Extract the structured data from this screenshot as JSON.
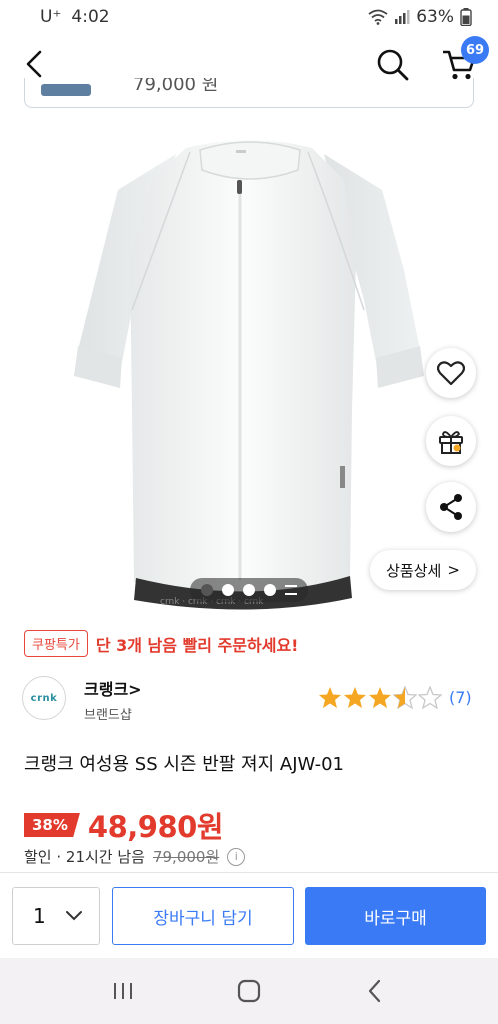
{
  "status_bar": {
    "carrier": "U⁺",
    "time": "4:02",
    "battery": "63%"
  },
  "top_nav": {
    "cart_count": "69"
  },
  "peek_card": {
    "price_fragment": "79,000 원"
  },
  "product_image": {
    "alt": "white cycling jersey",
    "carousel": {
      "total_dots": 4,
      "active_index": 0
    }
  },
  "floating_actions": {
    "detail_label": "상품상세",
    "detail_chevron": ">"
  },
  "urgency": {
    "badge": "쿠팡특가",
    "message": "단 3개 남음 빨리 주문하세요!"
  },
  "brand": {
    "logo_text": "crnk",
    "name": "크랭크>",
    "sub": "브랜드샵",
    "rating_value": 3.5,
    "rating_max": 5,
    "review_count": "(7)"
  },
  "product": {
    "title": "크랭크 여성용 SS 시즌 반팔 져지 AJW-01"
  },
  "price": {
    "discount": "38%",
    "sale_price": "48,980원",
    "meta_label": "할인 · 21시간 남음",
    "original_price": "79,000원",
    "info_icon": "i"
  },
  "buy_bar": {
    "quantity": "1",
    "add_to_cart": "장바구니 담기",
    "buy_now": "바로구매"
  },
  "colors": {
    "accent_blue": "#3a7bf5",
    "sale_red": "#e23a2c",
    "star_orange": "#f5a623"
  }
}
